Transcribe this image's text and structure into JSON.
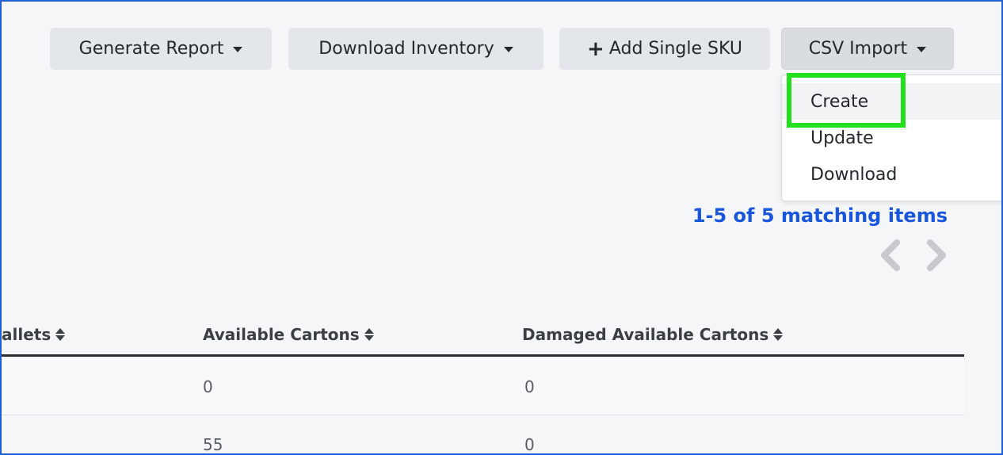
{
  "toolbar": {
    "generate_report_label": "Generate Report",
    "download_inventory_label": "Download Inventory",
    "add_single_sku_label": "Add Single SKU",
    "csv_import_label": "CSV Import"
  },
  "csv_dropdown": {
    "items": [
      {
        "label": "Create"
      },
      {
        "label": "Update"
      },
      {
        "label": "Download"
      }
    ]
  },
  "pagination": {
    "summary": "1-5 of 5 matching items"
  },
  "table": {
    "headers": {
      "pallets": "allets",
      "available_cartons": "Available Cartons",
      "damaged_available_cartons": "Damaged Available Cartons"
    },
    "rows": [
      {
        "available_cartons": "0",
        "damaged_available_cartons": "0"
      },
      {
        "available_cartons": "55",
        "damaged_available_cartons": "0"
      }
    ]
  },
  "colors": {
    "accent_link": "#1a56db",
    "highlight": "#22e01e",
    "frame_border": "#1f5fd6"
  }
}
